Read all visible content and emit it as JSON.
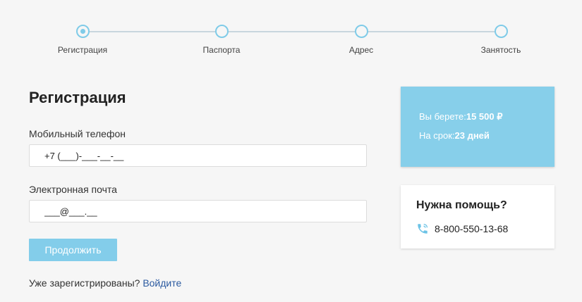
{
  "stepper": {
    "steps": [
      {
        "label": "Регистрация",
        "active": true
      },
      {
        "label": "Паспорта",
        "active": false
      },
      {
        "label": "Адрес",
        "active": false
      },
      {
        "label": "Занятость",
        "active": false
      }
    ]
  },
  "form": {
    "title": "Регистрация",
    "phone_label": "Мобильный телефон",
    "phone_value": "+7 (___)-___-__-__",
    "email_label": "Электронная почта",
    "email_value": "___@___.__",
    "continue_label": "Продолжить",
    "already_text": "Уже зарегистрированы?",
    "login_link": "Войдите"
  },
  "summary": {
    "amount_label": "Вы берете:",
    "amount_value": "15 500 ₽",
    "term_label": "На срок:",
    "term_value": "23 дней"
  },
  "help": {
    "title": "Нужна помощь?",
    "phone_icon": "phone-icon",
    "phone": "8-800-550-13-68"
  },
  "colors": {
    "accent": "#83cdea",
    "card": "#87cfea",
    "link": "#2b5aa0",
    "background": "#f6f6f6"
  }
}
